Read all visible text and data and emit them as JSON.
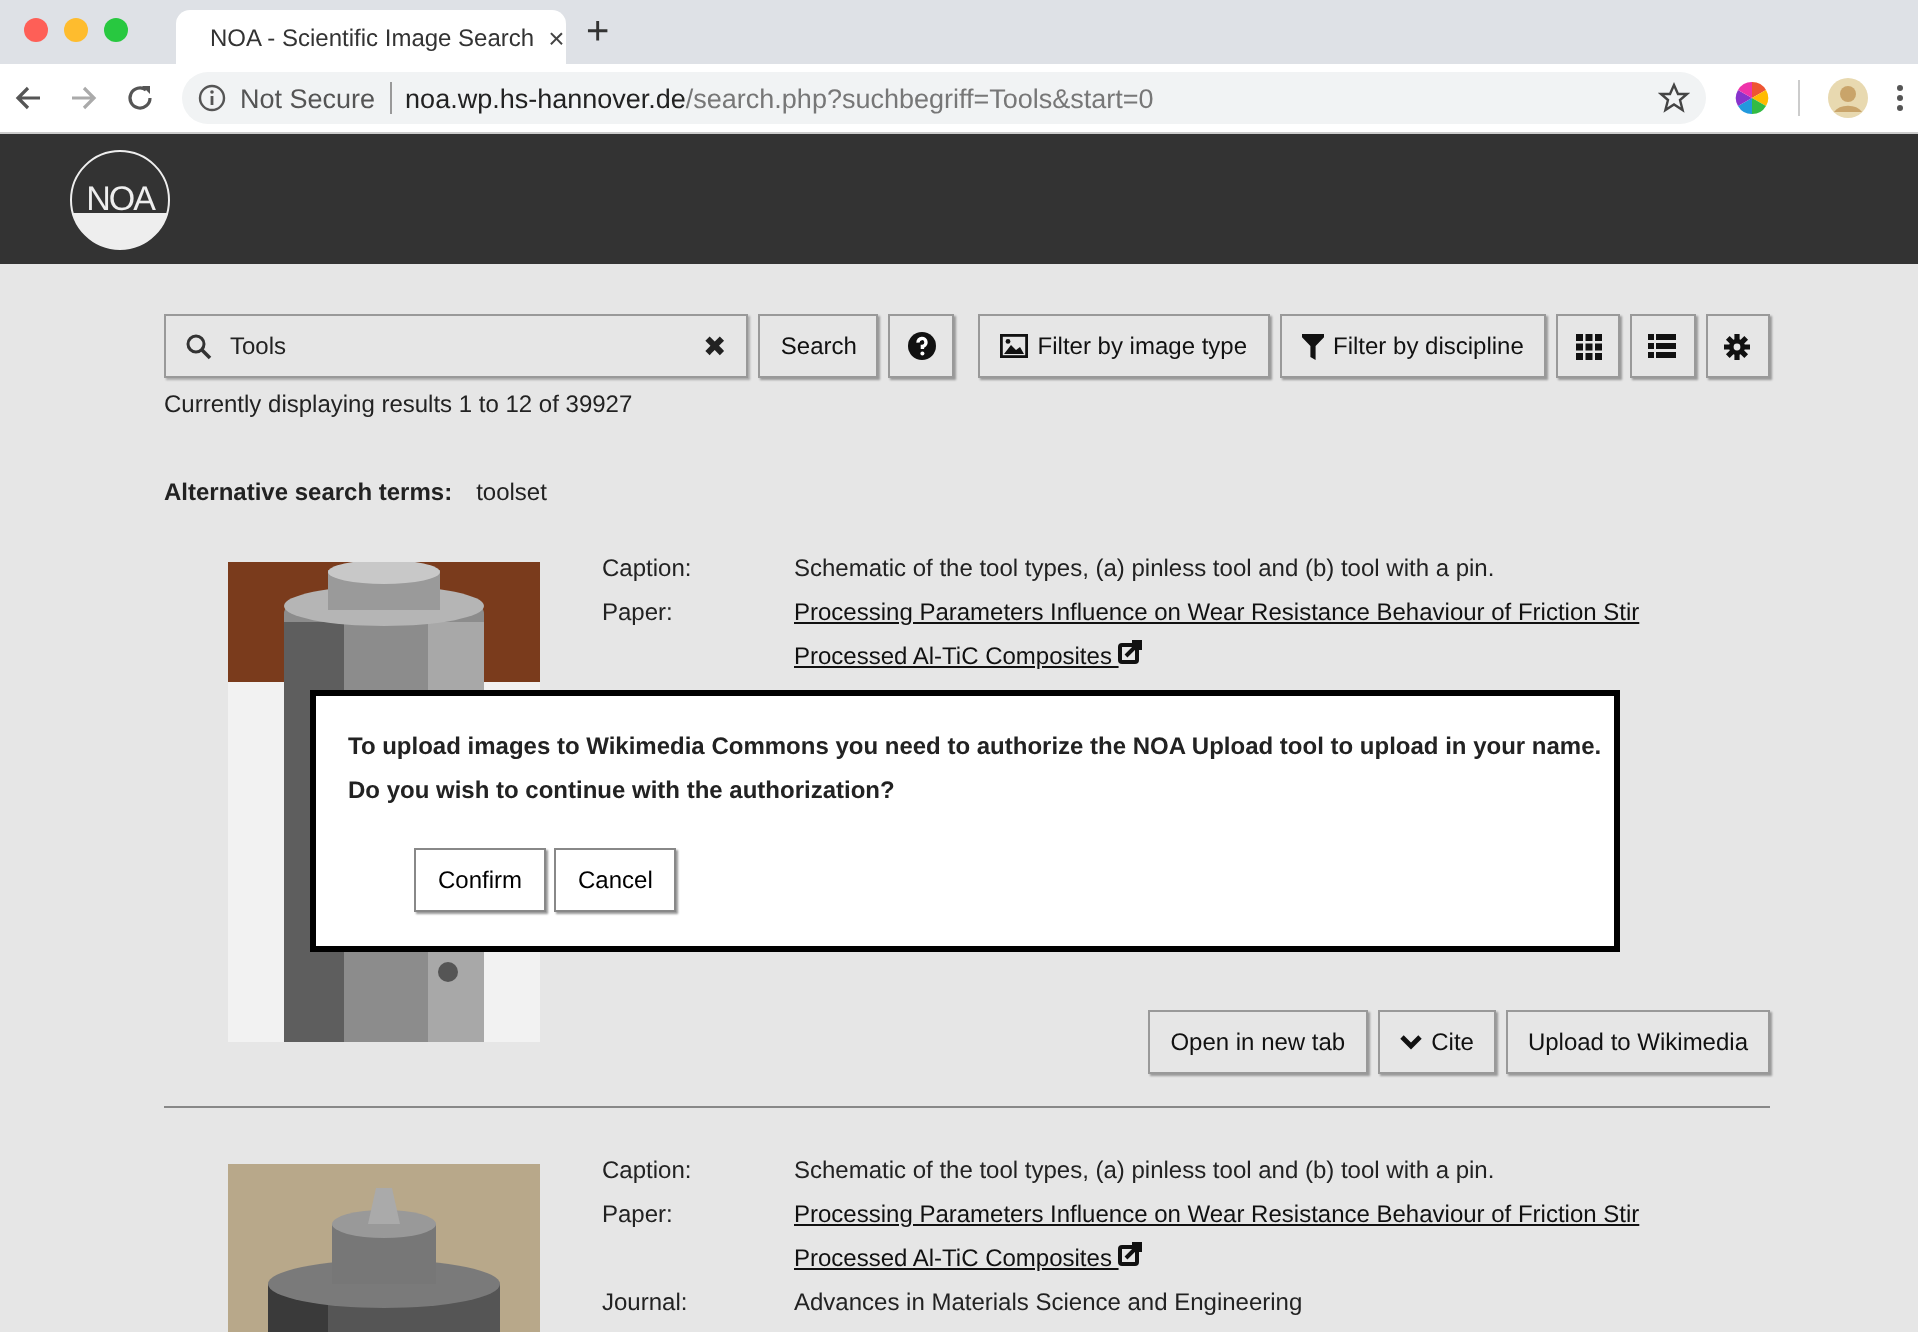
{
  "browser": {
    "tab_title": "NOA - Scientific Image Search",
    "tab_close": "×",
    "new_tab": "+",
    "security": "Not Secure",
    "url_host": "noa.wp.hs-hannover.de",
    "url_path": "/search.php?suchbegriff=Tools&start=0"
  },
  "header": {
    "logo": "NOA"
  },
  "search": {
    "value": "Tools",
    "clear": "✖",
    "button": "Search"
  },
  "toolbar": [
    {
      "kind": "help"
    },
    {
      "kind": "image-filter",
      "label": "Filter by image type"
    },
    {
      "kind": "discipline-filter",
      "label": "Filter by discipline"
    },
    {
      "kind": "grid"
    },
    {
      "kind": "list"
    },
    {
      "kind": "settings"
    }
  ],
  "status": "Currently displaying results 1 to 12 of 39927",
  "alternatives": {
    "label": "Alternative search terms:",
    "terms": "toolset"
  },
  "results": [
    {
      "rows_top": [
        {
          "label": "Caption:",
          "value": "Schematic of the tool types, (a) pinless tool and (b) tool with a pin.",
          "kind": "text"
        },
        {
          "label": "Paper:",
          "value": "Processing Parameters Influence on Wear Resistance Behaviour of Friction Stir Processed Al-TiC Composites",
          "kind": "link"
        }
      ],
      "actions": [
        {
          "kind": "plain",
          "label": "Open in new tab"
        },
        {
          "kind": "cite",
          "label": "Cite"
        },
        {
          "kind": "plain",
          "label": "Upload to Wikimedia"
        }
      ]
    },
    {
      "rows_top": [
        {
          "label": "Caption:",
          "value": "Schematic of the tool types, (a) pinless tool and (b) tool with a pin.",
          "kind": "text"
        },
        {
          "label": "Paper:",
          "value": "Processing Parameters Influence on Wear Resistance Behaviour of Friction Stir Processed Al-TiC Composites",
          "kind": "link"
        },
        {
          "label": "Journal:",
          "value": "Advances in Materials Science and Engineering",
          "kind": "text"
        }
      ]
    }
  ],
  "dialog": {
    "lines": [
      "To upload images to Wikimedia Commons you need to authorize the NOA Upload tool to upload in your name.",
      "Do you wish to continue with the authorization?"
    ],
    "buttons": [
      "Confirm",
      "Cancel"
    ]
  }
}
